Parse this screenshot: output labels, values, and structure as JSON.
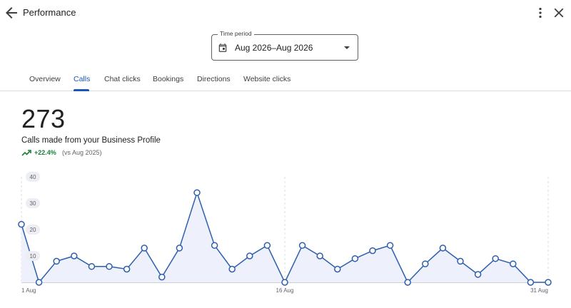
{
  "header": {
    "title": "Performance",
    "back_icon": "arrow-back-icon",
    "more_icon": "more-vert-icon",
    "close_icon": "close-icon"
  },
  "time_period": {
    "label": "Time period",
    "value": "Aug 2026–Aug 2026",
    "icon": "calendar-icon"
  },
  "tabs": [
    {
      "label": "Overview",
      "active": false
    },
    {
      "label": "Calls",
      "active": true
    },
    {
      "label": "Chat clicks",
      "active": false
    },
    {
      "label": "Bookings",
      "active": false
    },
    {
      "label": "Directions",
      "active": false
    },
    {
      "label": "Website clicks",
      "active": false
    }
  ],
  "summary": {
    "total": "273",
    "description": "Calls made from your Business Profile",
    "change": "+22.4%",
    "comparison": "(vs Aug 2025)"
  },
  "colors": {
    "accent": "#1a56b8",
    "line": "#2b5fae",
    "positive": "#188038",
    "fill": "#eef0fb"
  },
  "chart_data": {
    "type": "area",
    "x": [
      1,
      2,
      3,
      4,
      5,
      6,
      7,
      8,
      9,
      10,
      11,
      12,
      13,
      14,
      15,
      16,
      17,
      18,
      19,
      20,
      21,
      22,
      23,
      24,
      25,
      26,
      27,
      28,
      29,
      30,
      31
    ],
    "values": [
      22,
      0,
      8,
      10,
      6,
      6,
      5,
      13,
      2,
      13,
      34,
      14,
      5,
      10,
      14,
      0,
      14,
      10,
      5,
      9,
      12,
      14,
      0,
      7,
      13,
      8,
      3,
      9,
      7,
      0,
      0
    ],
    "y_ticks": [
      "40",
      "30",
      "20",
      "10"
    ],
    "ylim": [
      0,
      40
    ],
    "x_tick_labels": [
      {
        "x": 1,
        "label": "1 Aug"
      },
      {
        "x": 16,
        "label": "16 Aug"
      },
      {
        "x": 31,
        "label": "31 Aug"
      }
    ],
    "grid": "vertical dashed at tick positions"
  }
}
